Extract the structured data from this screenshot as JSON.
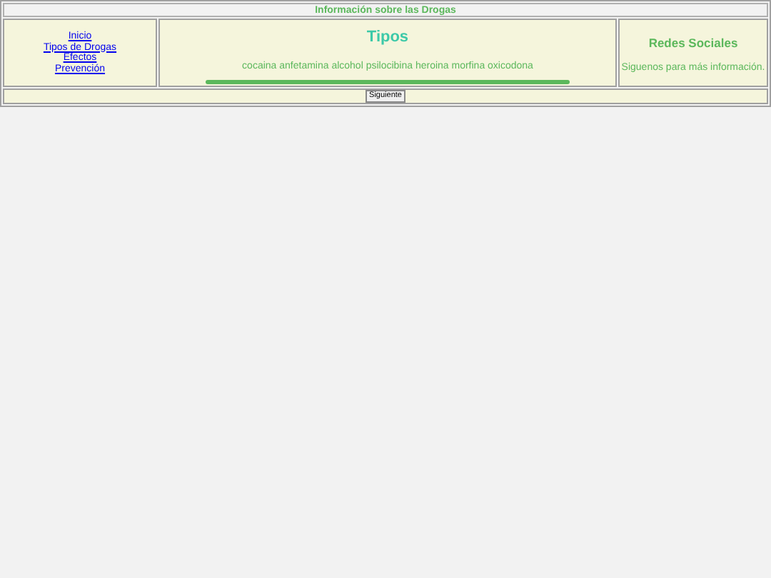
{
  "header": {
    "title": "Información sobre las Drogas"
  },
  "nav": {
    "links": [
      "Inicio",
      "Tipos de Drogas",
      "Efectos",
      "Prevención"
    ]
  },
  "main": {
    "heading": "Tipos",
    "text": "cocaina anfetamina alcohol psilocibina heroina morfina oxicodona"
  },
  "aside": {
    "heading": "Redes Sociales",
    "text": "Siguenos para más información."
  },
  "footer": {
    "button": "Siguiente"
  }
}
